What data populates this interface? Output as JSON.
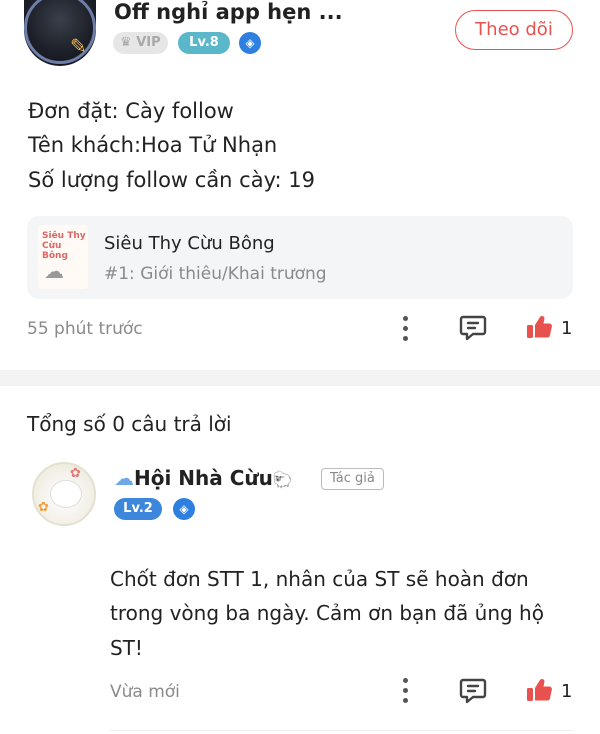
{
  "post": {
    "author": {
      "name": "Off nghỉ app hẹn ...",
      "vip_label": "VIP",
      "level_label": "Lv.8",
      "avatar_icon": "avatar-dark-character",
      "badge_icon": "drop-badge-icon"
    },
    "follow_label": "Theo dõi",
    "body": {
      "line1": "Đơn đặt: Cày follow",
      "line2": "Tên khách:Hoa Tử Nhạn",
      "line3": "Số lượng follow cần cày: 19"
    },
    "linked_card": {
      "title": "Siêu Thy Cừu Bông",
      "subtitle": "#1: Giới thiêu/Khai trương",
      "thumb_text": "Siêu Thy Cừu Bông"
    },
    "timestamp": "55 phút trước",
    "like_count": "1"
  },
  "answers_header": "Tổng số 0 câu trả lời",
  "reply": {
    "author": {
      "name": "Hội Nhà Cừu",
      "name_prefix_icon": "cloud-icon",
      "name_suffix_icon": "sheep-icon",
      "role_badge": "Tác giả",
      "level_label": "Lv.2",
      "badge_icon": "drop-badge-icon"
    },
    "text": {
      "line1": "Chốt đơn STT 1, nhân của ST sẽ hoàn đơn",
      "line2": "trong vòng ba ngày. Cảm ơn bạn đã ủng hộ",
      "line3": "ST!"
    },
    "timestamp": "Vừa mới",
    "like_count": "1"
  },
  "colors": {
    "accent_red": "#e8524e",
    "level8_teal": "#5ab7c9",
    "level2_blue": "#3c86db",
    "badge_blue": "#2d7fe0",
    "card_bg": "#f4f5f7",
    "muted_text": "#8a8a8a"
  }
}
